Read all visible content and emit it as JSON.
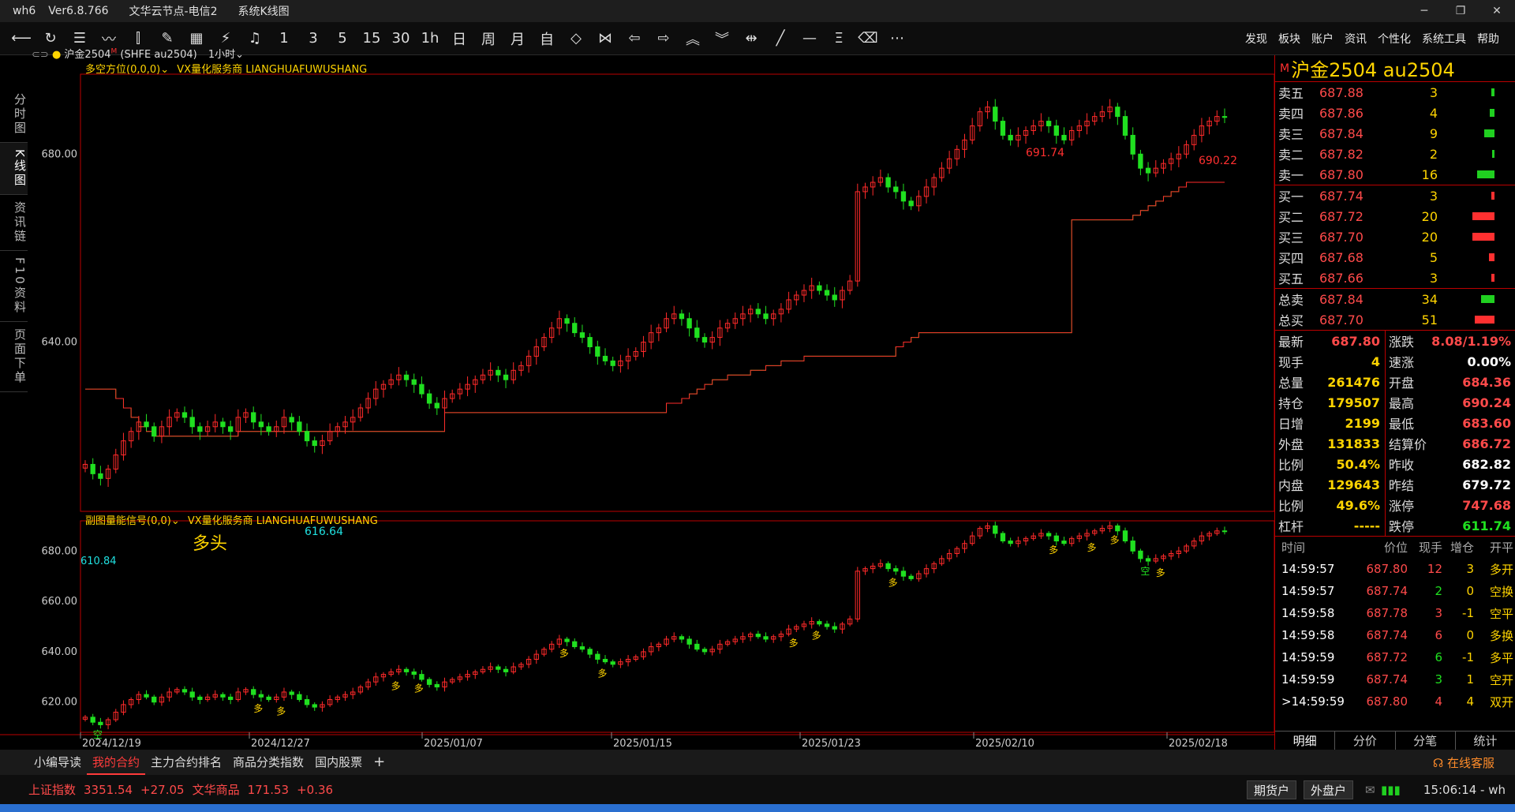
{
  "window": {
    "title_app": "wh6",
    "title_version": "Ver6.8.766",
    "title_node": "文华云节点-电信2",
    "title_view": "系统K线图",
    "btn_min": "─",
    "btn_max": "❐",
    "btn_close": "✕"
  },
  "toolbar": {
    "icons": [
      "back-icon",
      "refresh-icon",
      "list-icon",
      "line-chart-icon",
      "candle-icon",
      "brush-icon",
      "grid-icon",
      "lightning-icon",
      "bell-icon"
    ],
    "periods": [
      "1",
      "3",
      "5",
      "15",
      "30",
      "1h",
      "日",
      "周",
      "月",
      "自"
    ],
    "menu": [
      "发现",
      "板块",
      "账户",
      "资讯",
      "个性化",
      "系统工具",
      "帮助"
    ]
  },
  "lefttabs": [
    "分时图",
    "K线图",
    "资讯链",
    "F10资料",
    "页面下单"
  ],
  "chart": {
    "header_symbol": "沪金2504",
    "header_m": "M",
    "header_code": "(SHFE au2504)",
    "header_period": "1小时",
    "main_indicator": "多空方位(0,0,0)",
    "main_vendor": "VX量化服务商  LIANGHUAFUWUSHANG",
    "sub_indicator": "副图量能信号(0,0)",
    "sub_vendor": "VX量化服务商  LIANGHUAFUWUSHANG",
    "main_yticks": [
      "680.00",
      "640.00"
    ],
    "sub_yticks": [
      "680.00",
      "660.00",
      "640.00",
      "620.00"
    ],
    "dates": [
      "2024/12/19",
      "2024/12/27",
      "2025/01/07",
      "2025/01/15",
      "2025/01/23",
      "2025/02/10",
      "2025/02/18"
    ],
    "label_high1": "691.74",
    "label_high2": "690.22",
    "label_low": "616.64",
    "label_start": "610.84",
    "label_bull": "多头",
    "sig_long": "多",
    "sig_short": "空"
  },
  "chart_data": {
    "type": "candlestick",
    "main_ylim": [
      604,
      697
    ],
    "sub_ylim": [
      608,
      692
    ],
    "close": [
      614,
      612,
      611,
      613,
      616,
      619,
      621,
      623,
      622,
      620,
      622,
      624,
      625,
      624,
      622,
      621,
      622,
      623,
      622,
      621,
      624,
      625,
      623,
      622,
      621,
      622,
      624,
      623,
      621,
      619,
      618,
      619,
      621,
      622,
      623,
      624,
      626,
      628,
      630,
      631,
      632,
      633,
      632,
      631,
      629,
      627,
      626,
      628,
      629,
      630,
      631,
      632,
      633,
      634,
      633,
      632,
      634,
      635,
      637,
      639,
      641,
      643,
      645,
      644,
      642,
      641,
      639,
      637,
      636,
      635,
      636,
      637,
      638,
      640,
      642,
      643,
      645,
      646,
      645,
      643,
      641,
      640,
      641,
      643,
      644,
      645,
      646,
      647,
      646,
      645,
      646,
      647,
      649,
      650,
      651,
      652,
      651,
      650,
      649,
      651,
      653,
      672,
      673,
      674,
      675,
      673,
      672,
      670,
      669,
      671,
      673,
      675,
      677,
      679,
      681,
      683,
      686,
      689,
      690,
      687,
      684,
      683,
      684,
      685,
      686,
      687,
      686,
      684,
      683,
      685,
      686,
      687,
      688,
      689,
      690,
      688,
      684,
      680,
      677,
      676,
      677,
      678,
      679,
      680,
      682,
      684,
      686,
      687,
      688,
      687.8
    ],
    "stop_line": [
      630,
      630,
      630,
      630,
      628,
      626,
      624,
      622,
      621,
      620,
      620,
      620,
      620,
      620,
      620,
      620,
      620,
      620,
      620,
      620,
      621,
      621,
      621,
      621,
      621,
      621,
      621,
      621,
      621,
      621,
      621,
      621,
      621,
      621,
      621,
      621,
      621,
      621,
      621,
      621,
      621,
      621,
      621,
      621,
      621,
      621,
      621,
      625,
      625,
      625,
      625,
      625,
      625,
      625,
      625,
      625,
      625,
      625,
      625,
      625,
      625,
      625,
      625,
      625,
      625,
      625,
      625,
      625,
      625,
      625,
      625,
      625,
      625,
      625,
      625,
      625,
      627,
      627,
      628,
      629,
      630,
      631,
      632,
      632,
      633,
      633,
      633,
      634,
      634,
      635,
      635,
      636,
      636,
      636,
      637,
      637,
      637,
      637,
      637,
      637,
      637,
      637,
      637,
      637,
      637,
      637,
      639,
      640,
      641,
      642,
      642,
      642,
      642,
      642,
      642,
      642,
      642,
      642,
      642,
      642,
      642,
      642,
      642,
      642,
      642,
      642,
      642,
      642,
      642,
      666,
      666,
      666,
      666,
      666,
      666,
      666,
      666,
      667,
      668,
      669,
      670,
      671,
      672,
      673,
      674,
      674,
      674,
      674,
      674,
      674
    ],
    "last": 687.8
  },
  "quote": {
    "title": "沪金2504  au2504",
    "mark": "M",
    "asks": [
      {
        "label": "卖五",
        "price": "687.88",
        "vol": "3",
        "bar": 0.15
      },
      {
        "label": "卖四",
        "price": "687.86",
        "vol": "4",
        "bar": 0.2
      },
      {
        "label": "卖三",
        "price": "687.84",
        "vol": "9",
        "bar": 0.45
      },
      {
        "label": "卖二",
        "price": "687.82",
        "vol": "2",
        "bar": 0.1
      },
      {
        "label": "卖一",
        "price": "687.80",
        "vol": "16",
        "bar": 0.8
      }
    ],
    "bids": [
      {
        "label": "买一",
        "price": "687.74",
        "vol": "3",
        "bar": 0.15
      },
      {
        "label": "买二",
        "price": "687.72",
        "vol": "20",
        "bar": 1.0
      },
      {
        "label": "买三",
        "price": "687.70",
        "vol": "20",
        "bar": 1.0
      },
      {
        "label": "买四",
        "price": "687.68",
        "vol": "5",
        "bar": 0.25
      },
      {
        "label": "买五",
        "price": "687.66",
        "vol": "3",
        "bar": 0.15
      }
    ],
    "totals": [
      {
        "label": "总卖",
        "price": "687.84",
        "vol": "34",
        "bar": 0.6,
        "color": "#20d020"
      },
      {
        "label": "总买",
        "price": "687.70",
        "vol": "51",
        "bar": 0.9,
        "color": "#ff3030"
      }
    ],
    "stats_left": [
      {
        "k": "最新",
        "v": "687.80",
        "c": "red"
      },
      {
        "k": "现手",
        "v": "4",
        "c": "yellow"
      },
      {
        "k": "总量",
        "v": "261476",
        "c": "yellow"
      },
      {
        "k": "持仓",
        "v": "179507",
        "c": "yellow"
      },
      {
        "k": "日增",
        "v": "2199",
        "c": "yellow"
      },
      {
        "k": "外盘",
        "v": "131833",
        "c": "yellow"
      },
      {
        "k": "比例",
        "v": "50.4%",
        "c": "yellow"
      },
      {
        "k": "内盘",
        "v": "129643",
        "c": "yellow"
      },
      {
        "k": "比例",
        "v": "49.6%",
        "c": "yellow"
      },
      {
        "k": "杠杆",
        "v": "-----",
        "c": "yellow"
      }
    ],
    "stats_right": [
      {
        "k": "涨跌",
        "v": "8.08/1.19%",
        "c": "red"
      },
      {
        "k": "速涨",
        "v": "0.00%",
        "c": "white"
      },
      {
        "k": "开盘",
        "v": "684.36",
        "c": "red"
      },
      {
        "k": "最高",
        "v": "690.24",
        "c": "red"
      },
      {
        "k": "最低",
        "v": "683.60",
        "c": "red"
      },
      {
        "k": "结算价",
        "v": "686.72",
        "c": "red"
      },
      {
        "k": "昨收",
        "v": "682.82",
        "c": "white"
      },
      {
        "k": "昨结",
        "v": "679.72",
        "c": "white"
      },
      {
        "k": "涨停",
        "v": "747.68",
        "c": "red"
      },
      {
        "k": "跌停",
        "v": "611.74",
        "c": "green"
      }
    ],
    "tick_head": [
      "时间",
      "价位",
      "现手",
      "增仓",
      "开平"
    ],
    "ticks": [
      {
        "t": "14:59:57",
        "p": "687.80",
        "v": "12",
        "d": "3",
        "o": "多开",
        "pc": "red",
        "vc": "red",
        "oc": "yellow"
      },
      {
        "t": "14:59:57",
        "p": "687.74",
        "v": "2",
        "d": "0",
        "o": "空换",
        "pc": "red",
        "vc": "green",
        "oc": "yellow"
      },
      {
        "t": "14:59:58",
        "p": "687.78",
        "v": "3",
        "d": "-1",
        "o": "空平",
        "pc": "red",
        "vc": "red",
        "oc": "yellow"
      },
      {
        "t": "14:59:58",
        "p": "687.74",
        "v": "6",
        "d": "0",
        "o": "多换",
        "pc": "red",
        "vc": "red",
        "oc": "yellow"
      },
      {
        "t": "14:59:59",
        "p": "687.72",
        "v": "6",
        "d": "-1",
        "o": "多平",
        "pc": "red",
        "vc": "green",
        "oc": "yellow"
      },
      {
        "t": "14:59:59",
        "p": "687.74",
        "v": "3",
        "d": "1",
        "o": "空开",
        "pc": "red",
        "vc": "green",
        "oc": "yellow"
      },
      {
        "t": ">14:59:59",
        "p": "687.80",
        "v": "4",
        "d": "4",
        "o": "双开",
        "pc": "red",
        "vc": "red",
        "oc": "yellow"
      }
    ],
    "tabs": [
      "明细",
      "分价",
      "分笔",
      "统计"
    ]
  },
  "bottomtabs": [
    "小编导读",
    "我的合约",
    "主力合约排名",
    "商品分类指数",
    "国内股票",
    "+"
  ],
  "service": "在线客服",
  "status": {
    "idx1_name": "上证指数",
    "idx1_val": "3351.54",
    "idx1_chg": "+27.05",
    "idx2_name": "文华商品",
    "idx2_val": "171.53",
    "idx2_chg": "+0.36",
    "acct1": "期货户",
    "acct2": "外盘户",
    "clock": "15:06:14 - wh"
  }
}
